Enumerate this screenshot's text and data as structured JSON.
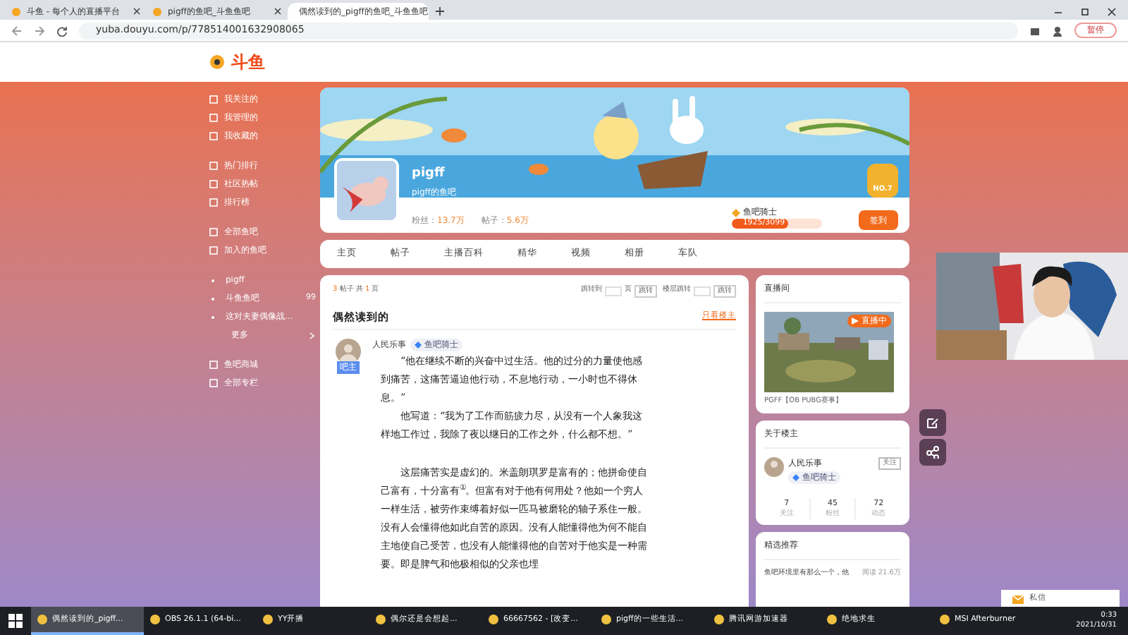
{
  "browser": {
    "tabs": [
      {
        "title": "斗鱼 - 每个人的直播平台",
        "selected": false
      },
      {
        "title": "pigff的鱼吧_斗鱼鱼吧",
        "selected": false
      },
      {
        "title": "偶然读到的_pigff的鱼吧_斗鱼鱼吧",
        "selected": true
      }
    ],
    "url": "yuba.douyu.com/p/778514001632908065",
    "profile_button": "暂停"
  },
  "header": {
    "logo": "斗鱼"
  },
  "sidebar": [
    {
      "items": [
        {
          "label": "我关注的",
          "kind": "nav"
        },
        {
          "label": "我管理的",
          "kind": "nav"
        },
        {
          "label": "我收藏的",
          "kind": "nav"
        }
      ]
    },
    {
      "items": [
        {
          "label": "热门排行",
          "kind": "nav"
        },
        {
          "label": "社区热帖",
          "kind": "nav"
        },
        {
          "label": "排行榜",
          "kind": "nav"
        }
      ]
    },
    {
      "items": [
        {
          "label": "全部鱼吧",
          "kind": "nav"
        },
        {
          "label": "加入的鱼吧",
          "kind": "nav"
        }
      ]
    },
    {
      "items": [
        {
          "label": "pigff",
          "kind": "bar"
        },
        {
          "label": "斗鱼鱼吧",
          "kind": "bar",
          "count": "99"
        },
        {
          "label": "这对夫妻偶像战...",
          "kind": "bar"
        },
        {
          "label": "更多",
          "kind": "more"
        }
      ]
    },
    {
      "items": [
        {
          "label": "鱼吧商城",
          "kind": "nav"
        },
        {
          "label": "全部专栏",
          "kind": "nav"
        }
      ]
    }
  ],
  "profile": {
    "name": "pigff",
    "subtitle": "pigff的鱼吧",
    "stats": [
      {
        "label": "粉丝：",
        "value": "13.7万"
      },
      {
        "label": "帖子：",
        "value": "5.6万"
      }
    ],
    "rank": "NO.7",
    "level_name": "鱼吧骑士",
    "level": 0.62,
    "level_text": "1925/3099",
    "sign_in": "签到"
  },
  "nav_tabs": [
    {
      "label": "主页",
      "selected": false
    },
    {
      "label": "帖子",
      "selected": false
    },
    {
      "label": "主播百科",
      "selected": false
    },
    {
      "label": "精华",
      "selected": false
    },
    {
      "label": "视频",
      "selected": false
    },
    {
      "label": "相册",
      "selected": false
    },
    {
      "label": "车队",
      "selected": false
    }
  ],
  "thread": {
    "count": "3",
    "count_label": "帖子 共",
    "pages": "1",
    "pages_label": "页",
    "jump_label": "跳转到",
    "page_unit": "页",
    "jump_button": "跳转",
    "floor_label": "楼层跳转",
    "floor_button": "跳转",
    "title": "偶然读到的",
    "only_op": "只看楼主",
    "post": {
      "author": "人民乐事",
      "badge": "鱼吧骑士",
      "role": "吧主",
      "paragraphs": [
        {
          "text": "“他在继续不断的兴奋中过生活。他的过分的力量使他感到痛苦，这痛苦逼迫他行动，不息地行动，一小时也不得休息。”",
          "gap": false
        },
        {
          "text": "他写道：“我为了工作而筋疲力尽，从没有一个人象我这样地工作过，我除了夜以继日的工作之外，什么都不想。”",
          "gap": false
        },
        {
          "text": "这层痛苦实是虚幻的。米盖朗琪罗是富有的；他拼命使自己富有，十分富有$^{①}$。但富有对于他有何用处？他如一个穷人一样生活，被劳作束缚着好似一匹马被磨轮的轴子系住一般。没有人会懂得他如此自苦的原因。没有人能懂得他为何不能自主地使自己受苦，也没有人能懂得他的自苦对于他实是一种需要。即是脾气和他极相似的父亲也埋",
          "gap": true
        }
      ]
    }
  },
  "live": {
    "title": "直播间",
    "badge": "直播中",
    "caption": "PGFF【OB PUBG赛事】"
  },
  "op_card": {
    "title": "关于楼主",
    "name": "人民乐事",
    "badge": "鱼吧骑士",
    "follow": "关注",
    "stats": [
      {
        "value": "7",
        "label": "关注"
      },
      {
        "value": "45",
        "label": "粉丝"
      },
      {
        "value": "72",
        "label": "动态"
      }
    ]
  },
  "recommend": {
    "title": "精选推荐",
    "items": [
      {
        "title": "鱼吧环境里有那么一个，他",
        "reads": "阅读 21.6万"
      }
    ]
  },
  "message": {
    "label": "私信"
  },
  "taskbar": {
    "items": [
      {
        "label": "偶然读到的_pigff...",
        "selected": true
      },
      {
        "label": "OBS 26.1.1 (64-bi...",
        "selected": false
      },
      {
        "label": "YY开播",
        "selected": false
      },
      {
        "label": "偶尔还是会想起...",
        "selected": false
      },
      {
        "label": "66667562 - [改变...",
        "selected": false
      },
      {
        "label": "pigff的一些生活...",
        "selected": false
      },
      {
        "label": "腾讯网游加速器",
        "selected": false
      },
      {
        "label": "绝地求生",
        "selected": false
      },
      {
        "label": "MSI Afterburner",
        "selected": false
      }
    ],
    "time": "0:33",
    "date": "2021/10/31"
  }
}
